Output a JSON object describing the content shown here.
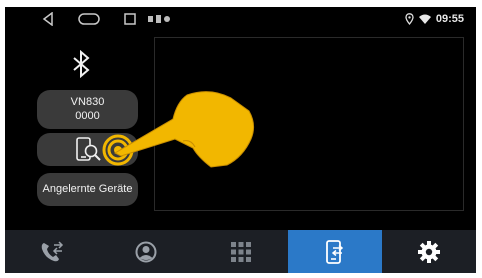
{
  "status": {
    "time": "09:55"
  },
  "bluetooth": {
    "device_name": "VN830",
    "pin": "0000",
    "paired_devices_label": "Angelernte Geräte"
  },
  "bottom_nav": [
    {
      "icon": "phone-transfer-icon"
    },
    {
      "icon": "contacts-icon"
    },
    {
      "icon": "keypad-grid-icon"
    },
    {
      "icon": "phone-link-icon",
      "active": true
    },
    {
      "icon": "settings-gear-icon"
    }
  ],
  "colors": {
    "accent": "#2b79c8",
    "pointer_hand": "#f2b700",
    "background": "#000000",
    "pill": "#3a3a3a"
  }
}
